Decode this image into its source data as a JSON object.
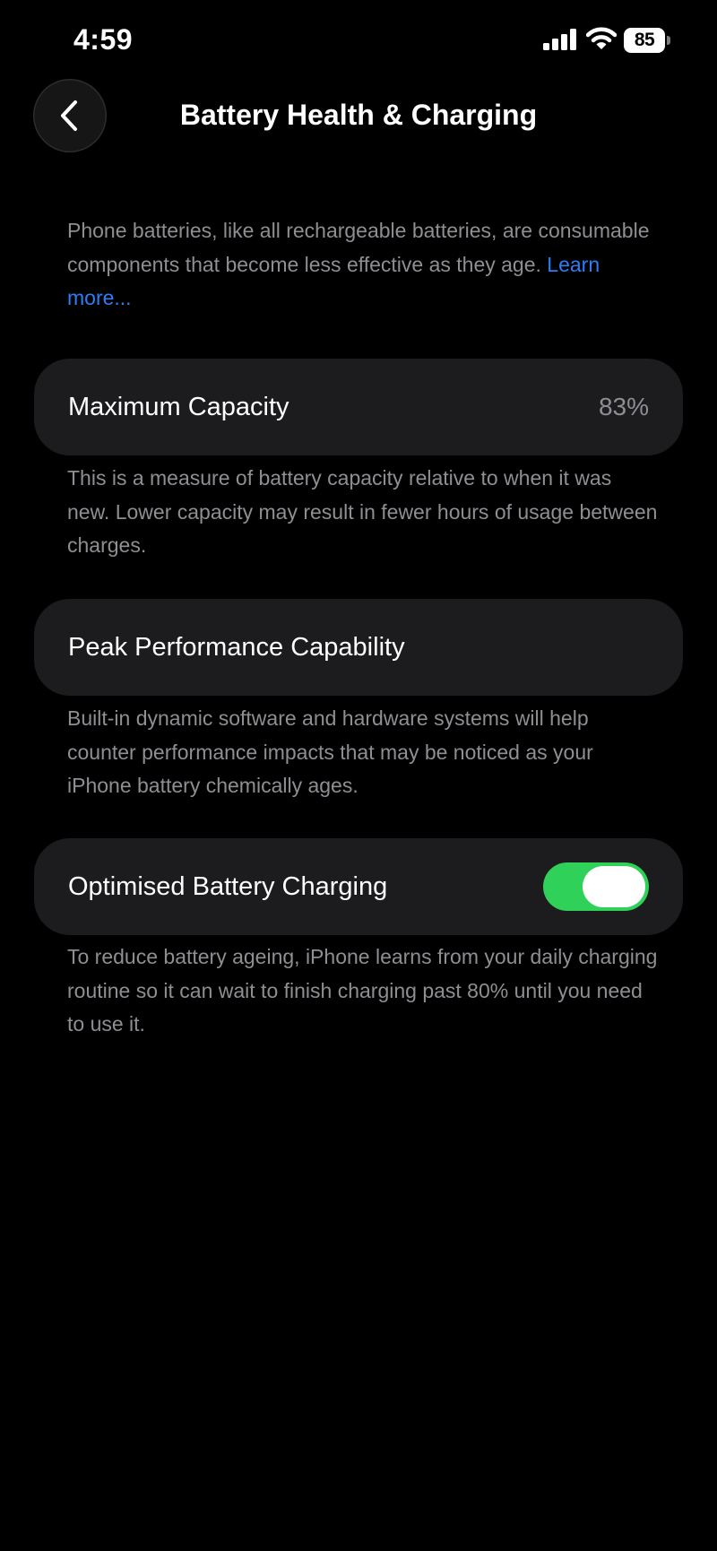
{
  "status_bar": {
    "time": "4:59",
    "battery_percent": "85",
    "icons": [
      "signal-icon",
      "wifi-icon",
      "battery-icon"
    ]
  },
  "nav": {
    "back_icon": "chevron-left-icon",
    "title": "Battery Health & Charging"
  },
  "intro": {
    "text": "Phone batteries, like all rechargeable batteries, are consumable components that become less effective as they age. ",
    "link": "Learn more..."
  },
  "maximum_capacity": {
    "label": "Maximum Capacity",
    "value": "83%",
    "description": "This is a measure of battery capacity relative to when it was new. Lower capacity may result in fewer hours of usage between charges."
  },
  "peak_performance": {
    "label": "Peak Performance Capability",
    "description": "Built-in dynamic software and hardware systems will help counter performance impacts that may be noticed as your iPhone battery chemically ages."
  },
  "optimised_charging": {
    "label": "Optimised Battery Charging",
    "enabled": true,
    "description": "To reduce battery ageing, iPhone learns from your daily charging routine so it can wait to finish charging past 80% until you need to use it."
  },
  "colors": {
    "background": "#000000",
    "card": "#1c1c1e",
    "secondary_text": "#8e8e93",
    "link": "#2f7cf6",
    "toggle_on": "#30d158"
  }
}
